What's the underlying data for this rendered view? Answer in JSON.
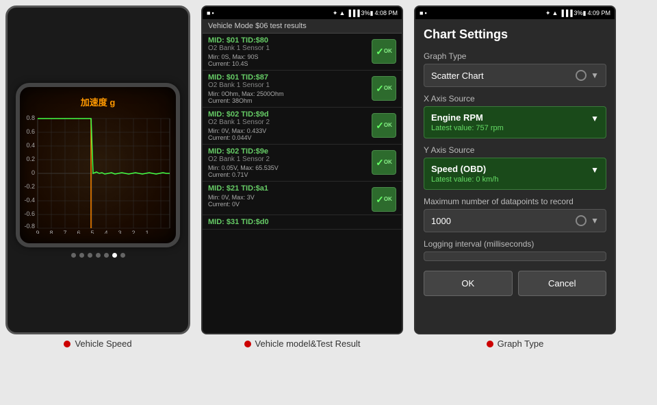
{
  "panels": {
    "speed": {
      "title": "加速度 g",
      "caption": "Vehicle Speed",
      "page_dots": [
        false,
        false,
        false,
        false,
        false,
        true,
        false
      ],
      "y_axis": [
        "0.8",
        "0.6",
        "0.4",
        "0.2",
        "0",
        "-0.2",
        "-0.4",
        "-0.6",
        "-0.8"
      ],
      "x_axis": [
        "9",
        "8",
        "7",
        "6",
        "5",
        "4",
        "3",
        "2",
        "1"
      ]
    },
    "test_result": {
      "header": "Vehicle Mode $06 test results",
      "caption": "Vehicle model&Test Result",
      "items": [
        {
          "mid": "MID: $01 TID:$80",
          "sensor": "O2 Bank 1 Sensor 1",
          "min_max": "Min: 0S, Max: 90S",
          "current": "Current: 10.4S",
          "ok": true
        },
        {
          "mid": "MID: $01 TID:$87",
          "sensor": "O2 Bank 1 Sensor 1",
          "min_max": "Min: 0Ohm, Max: 2500Ohm",
          "current": "Current: 38Ohm",
          "ok": true
        },
        {
          "mid": "MID: $02 TID:$9d",
          "sensor": "O2 Bank 1 Sensor 2",
          "min_max": "Min: 0V, Max: 0.433V",
          "current": "Current: 0.044V",
          "ok": true
        },
        {
          "mid": "MID: $02 TID:$9e",
          "sensor": "O2 Bank 1 Sensor 2",
          "min_max": "Min: 0.05V, Max: 65.535V",
          "current": "Current: 0.71V",
          "ok": true
        },
        {
          "mid": "MID: $21 TID:$a1",
          "sensor": "",
          "min_max": "Min: 0V, Max: 3V",
          "current": "Current: 0V",
          "ok": true
        },
        {
          "mid": "MID: $31 TID:$d0",
          "sensor": "",
          "min_max": "",
          "current": "",
          "ok": false
        }
      ]
    },
    "chart_settings": {
      "caption": "Graph Type",
      "title": "Chart Settings",
      "graph_type_label": "Graph Type",
      "graph_type_value": "Scatter Chart",
      "x_axis_label": "X Axis Source",
      "x_axis_value": "Engine RPM",
      "x_axis_latest": "Latest value: 757 rpm",
      "y_axis_label": "Y Axis Source",
      "y_axis_value": "Speed (OBD)",
      "y_axis_latest": "Latest value: 0 km/h",
      "max_datapoints_label": "Maximum number of datapoints to record",
      "max_datapoints_value": "1000",
      "logging_label": "Logging interval (milliseconds)",
      "ok_button": "OK",
      "cancel_button": "Cancel"
    }
  },
  "status_bar_left": {
    "icons_2": "● ■",
    "time_2": "4:08 PM",
    "time_3": "4:09 PM"
  }
}
